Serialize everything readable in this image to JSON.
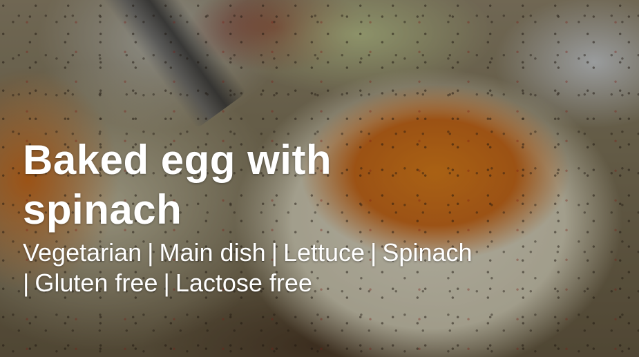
{
  "hero": {
    "title": "Baked egg with spinach",
    "tags": [
      "Vegetarian",
      "Main dish",
      "Lettuce",
      "Spinach",
      "Gluten free",
      "Lactose free"
    ],
    "separator": "|",
    "text_color": "#ffffff"
  }
}
